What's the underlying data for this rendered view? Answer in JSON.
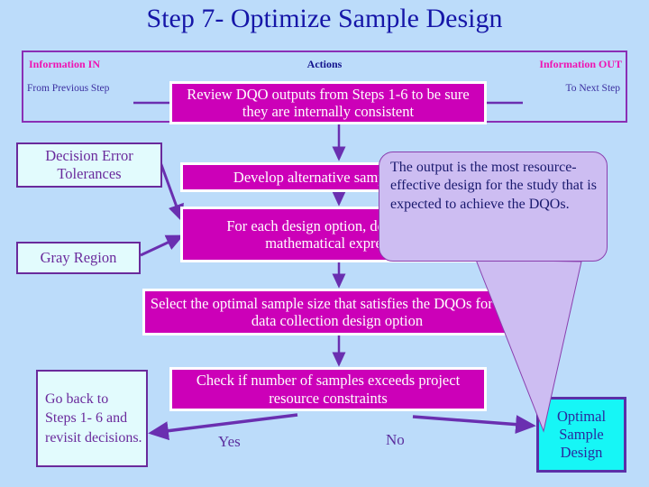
{
  "title": "Step 7- Optimize Sample Design",
  "header": {
    "information_in": "Information IN",
    "actions": "Actions",
    "information_out": "Information OUT",
    "from_previous_step": "From Previous Step",
    "to_next_step": "To Next Step"
  },
  "actions": {
    "review": "Review DQO outputs from Steps 1-6 to be sure they are internally consistent",
    "develop": "Develop alternative sample designs",
    "for_each": "For each design option, determine the mathematical expression",
    "select": "Select the optimal sample size that satisfies the DQOs for each data collection design option",
    "check": "Check if number of samples exceeds project resource constraints"
  },
  "inputs": {
    "decision_error_tolerances": "Decision Error Tolerances",
    "gray_region": "Gray Region",
    "go_back": "Go back to Steps 1- 6 and revisit decisions."
  },
  "outputs": {
    "optimal_sample_design": "Optimal Sample Design"
  },
  "flow_labels": {
    "yes": "Yes",
    "no": "No"
  },
  "callout": {
    "text": "The output is the most resource-effective design for the study that is expected to achieve the DQOs."
  },
  "colors": {
    "background": "#bcdcfa",
    "title": "#1616a8",
    "action_fill": "#cc00b8",
    "action_text": "#ffffff",
    "info_fill": "#e2fbfd",
    "info_border": "#6a2a9c",
    "out_fill": "#16f6f6",
    "out_border": "#5b2fa8",
    "header_label_magenta": "#ef12b2",
    "header_label_blue": "#12128c",
    "callout_fill": "#cdbdf2",
    "callout_border": "#8a3fae",
    "arrow": "#6a2fb0"
  }
}
